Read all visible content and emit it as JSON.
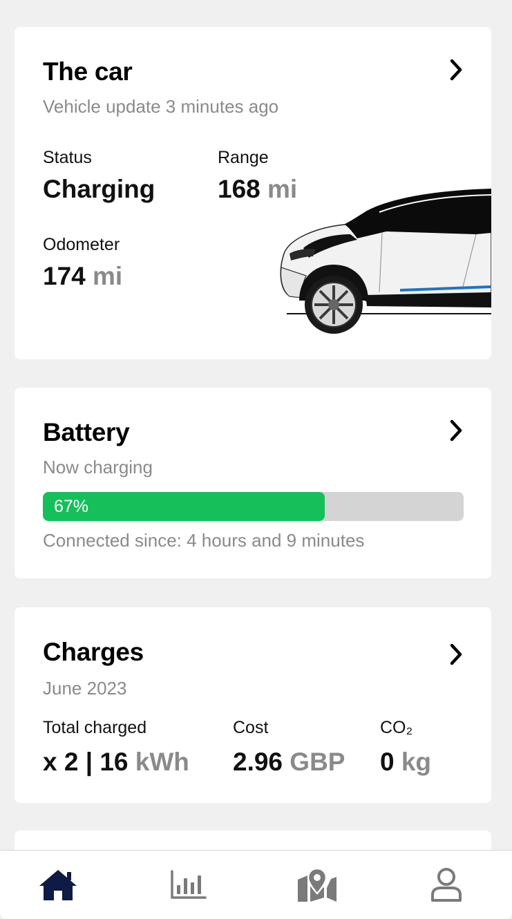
{
  "car_card": {
    "title": "The car",
    "subtitle": "Vehicle update 3 minutes ago",
    "status_label": "Status",
    "status_value": "Charging",
    "range_label": "Range",
    "range_value": "168",
    "range_unit": "mi",
    "odometer_label": "Odometer",
    "odometer_value": "174",
    "odometer_unit": "mi"
  },
  "battery_card": {
    "title": "Battery",
    "subtitle": "Now charging",
    "percent_text": "67%",
    "percent": 67,
    "connected": "Connected since: 4 hours and 9 minutes"
  },
  "charges_card": {
    "title": "Charges",
    "subtitle": "June 2023",
    "total_label": "Total charged",
    "total_value": "x 2 | 16",
    "total_unit": "kWh",
    "cost_label": "Cost",
    "cost_value": "2.96",
    "cost_unit": "GBP",
    "co2_label": "CO₂",
    "co2_value": "0",
    "co2_unit": "kg"
  },
  "bottom_nav": {
    "items": [
      {
        "icon": "home-icon",
        "active": true
      },
      {
        "icon": "chart-icon",
        "active": false
      },
      {
        "icon": "map-pin-icon",
        "active": false
      },
      {
        "icon": "user-icon",
        "active": false
      }
    ]
  },
  "colors": {
    "progress_fill": "#15c05b",
    "progress_track": "#d4d4d4",
    "nav_active": "#0f1a45",
    "nav_inactive": "#7a7a7a",
    "muted_text": "#8a8a8a",
    "accent_blue": "#1e73c8"
  }
}
